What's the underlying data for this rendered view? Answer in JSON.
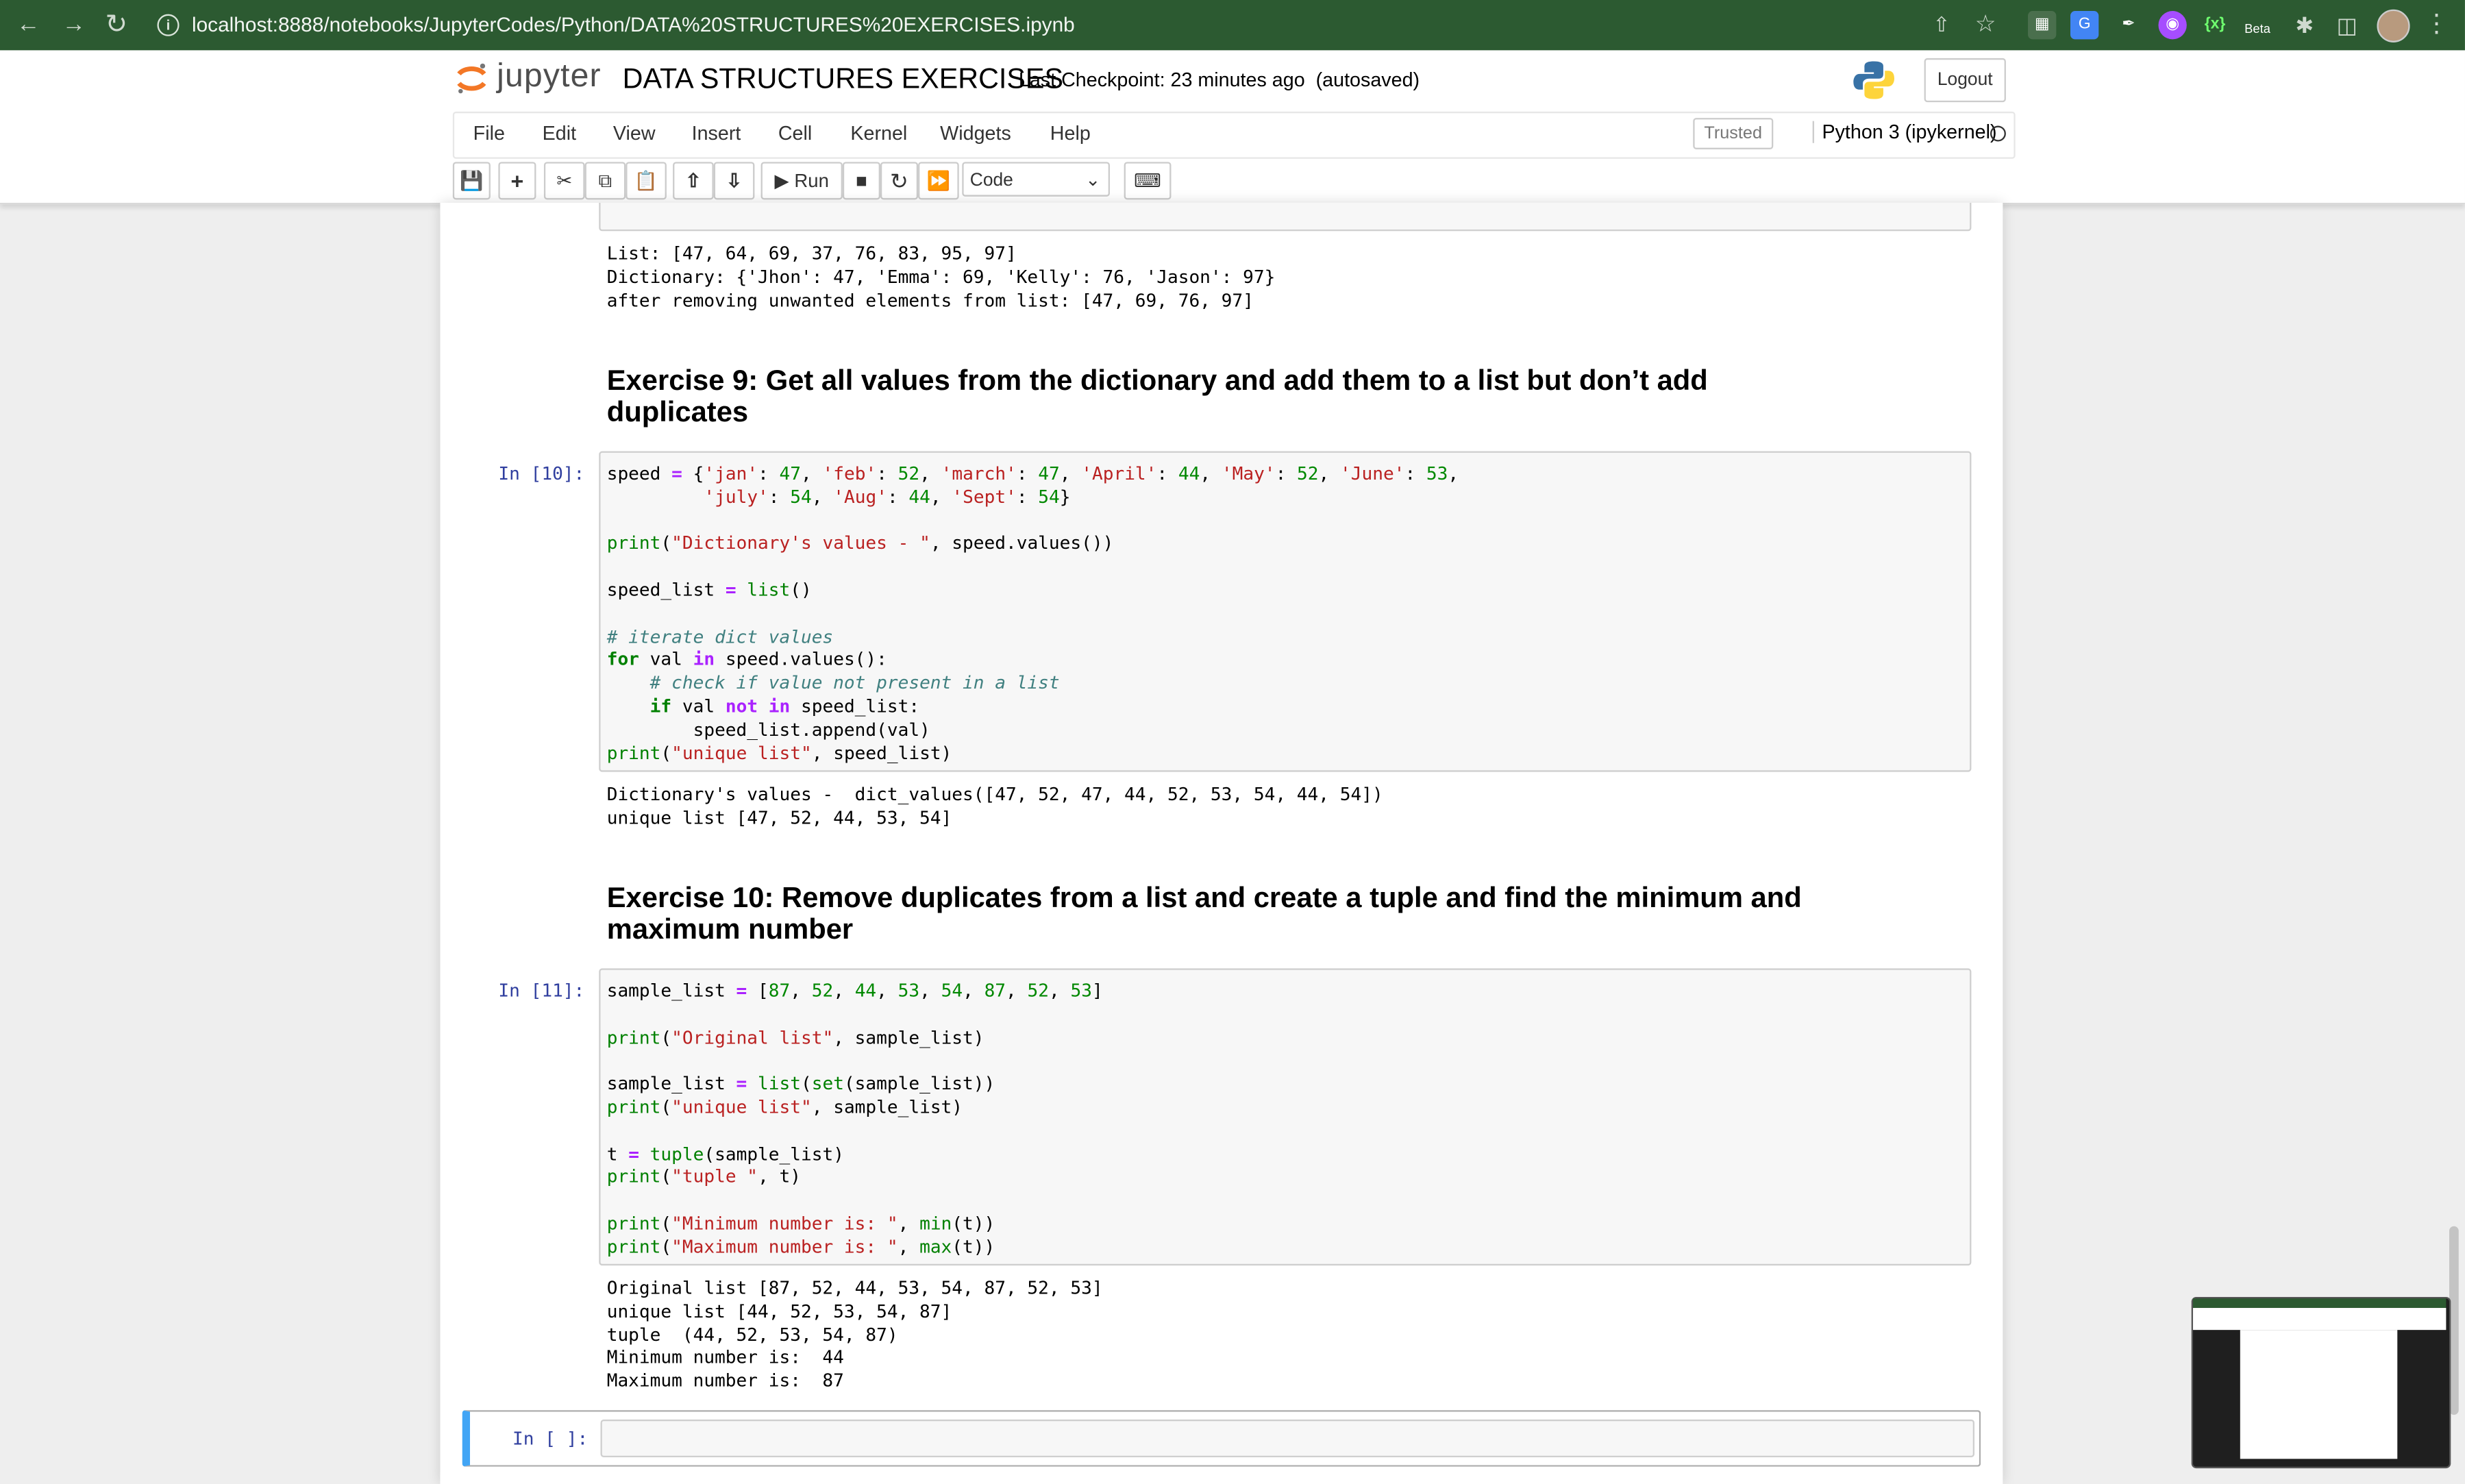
{
  "browser": {
    "url": "localhost:8888/notebooks/JupyterCodes/Python/DATA%20STRUCTURES%20EXERCISES.ipynb",
    "icons": [
      "back-icon",
      "forward-icon",
      "reload-icon",
      "info-icon",
      "share-icon",
      "star-icon",
      "extensions-icon",
      "sidebar-icon",
      "profile-avatar",
      "more-icon"
    ],
    "ext_beta_label": "Beta"
  },
  "header": {
    "logo_text": "jupyter",
    "notebook_title": "DATA STRUCTURES EXERCISES",
    "checkpoint": "Last Checkpoint: 23 minutes ago",
    "autosaved": "(autosaved)",
    "logout_label": "Logout"
  },
  "menu": {
    "items": [
      "File",
      "Edit",
      "View",
      "Insert",
      "Cell",
      "Kernel",
      "Widgets",
      "Help"
    ],
    "trusted": "Trusted",
    "kernel": "Python 3 (ipykernel)"
  },
  "toolbar": {
    "run_label": "Run",
    "cell_type": "Code"
  },
  "notebook": {
    "prev_output": [
      "List: [47, 64, 69, 37, 76, 83, 95, 97]",
      "Dictionary: {'Jhon': 47, 'Emma': 69, 'Kelly': 76, 'Jason': 97}",
      "after removing unwanted elements from list: [47, 69, 76, 97]"
    ],
    "ex9": {
      "heading_line1": "Exercise 9: Get all values from the dictionary and add them to a list but don’t add",
      "heading_line2": "duplicates",
      "prompt": "In [10]:",
      "output": [
        "Dictionary's values -  dict_values([47, 52, 47, 44, 52, 53, 54, 44, 54])",
        "unique list [47, 52, 44, 53, 54]"
      ]
    },
    "ex10": {
      "heading_line1": "Exercise 10: Remove duplicates from a list and create a tuple and find the minimum and",
      "heading_line2": "maximum number",
      "prompt": "In [11]:",
      "output": [
        "Original list [87, 52, 44, 53, 54, 87, 52, 53]",
        "unique list [44, 52, 53, 54, 87]",
        "tuple  (44, 52, 53, 54, 87)",
        "Minimum number is:  44",
        "Maximum number is:  87"
      ]
    },
    "empty_prompt": "In [ ]:"
  },
  "colors": {
    "chrome_bg": "#2c5a31",
    "selected_cell_border": "#42a5f5",
    "prompt_in": "#303f9f"
  }
}
